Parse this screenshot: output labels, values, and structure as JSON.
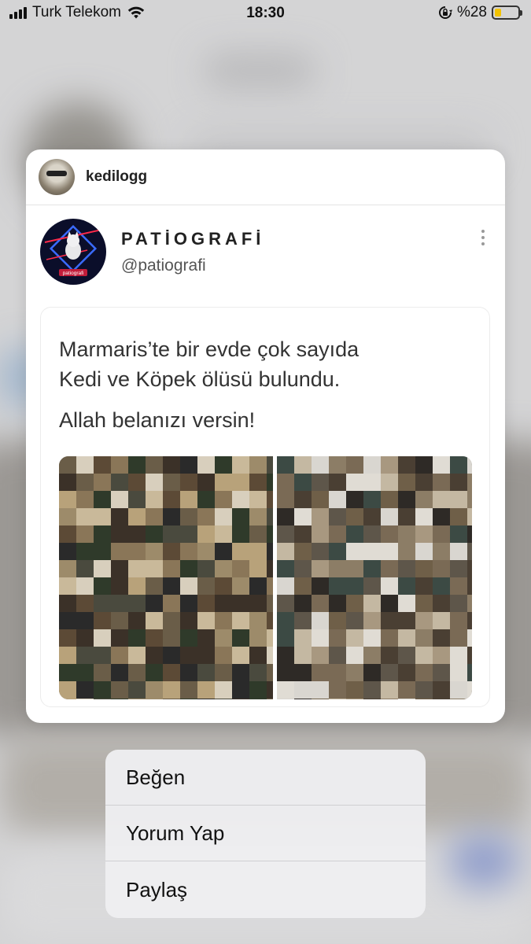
{
  "status_bar": {
    "carrier": "Turk Telekom",
    "time": "18:30",
    "battery_text": "%28",
    "battery_level": 0.28,
    "icons": [
      "signal-icon",
      "wifi-icon",
      "orientation-lock-icon",
      "battery-icon"
    ]
  },
  "preview": {
    "username": "kedilogg",
    "tweet": {
      "display_name": "PATİOGRAFİ",
      "handle": "@patiografi",
      "text_line_1": "Marmaris’te bir evde çok sayıda",
      "text_line_2": "Kedi ve Köpek ölüsü bulundu.",
      "text_line_3": "Allah belanızı versin!",
      "avatar_caption": "patiografi"
    }
  },
  "menu": {
    "items": [
      {
        "label": "Beğen"
      },
      {
        "label": "Yorum Yap"
      },
      {
        "label": "Paylaş"
      }
    ]
  },
  "colors": {
    "battery_fill": "#f2c200",
    "card_background": "#ffffff",
    "menu_background": "#eeeef0"
  }
}
